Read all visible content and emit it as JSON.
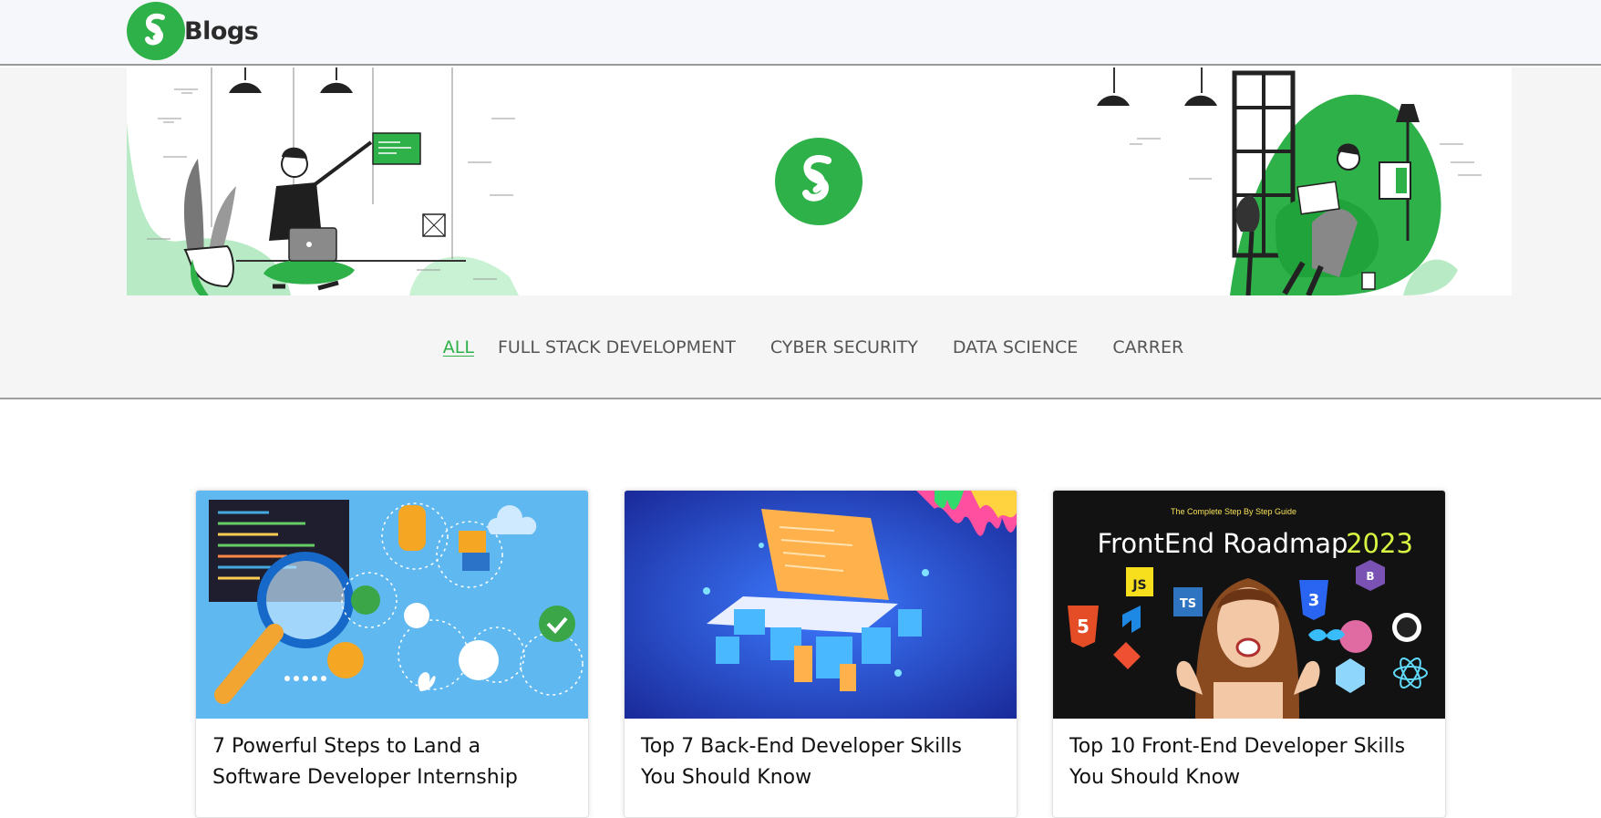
{
  "header": {
    "brand_text": "Blogs",
    "logo_icon": "gfg-logo-icon",
    "accent_color": "#2fb14a"
  },
  "categories": [
    {
      "label": "ALL",
      "active": true
    },
    {
      "label": "FULL STACK DEVELOPMENT",
      "active": false
    },
    {
      "label": "CYBER SECURITY",
      "active": false
    },
    {
      "label": "DATA SCIENCE",
      "active": false
    },
    {
      "label": "CARRER",
      "active": false
    }
  ],
  "cards": [
    {
      "title": "7 Powerful Steps to Land a Software Developer Internship"
    },
    {
      "title": "Top 7 Back-End Developer Skills You Should Know"
    },
    {
      "title": "Top 10 Front-End Developer Skills You Should Know",
      "image_caption": "The Complete Step By Step Guide",
      "image_heading": "FrontEnd Roadmap",
      "image_year": "2023",
      "image_badges": [
        "JS",
        "TS",
        "5",
        "3",
        "B"
      ]
    }
  ]
}
